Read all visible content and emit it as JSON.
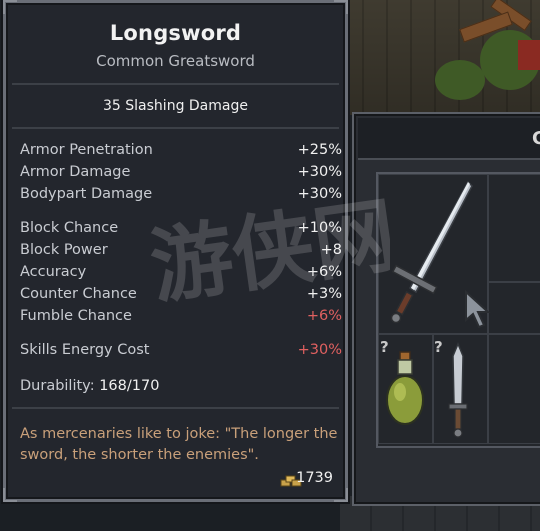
{
  "tooltip": {
    "title": "Longsword",
    "subtitle": "Common Greatsword",
    "damage": "35 Slashing Damage",
    "stats_group_1": [
      {
        "label": "Armor Penetration",
        "value": "+25%",
        "negative": false
      },
      {
        "label": "Armor Damage",
        "value": "+30%",
        "negative": false
      },
      {
        "label": "Bodypart Damage",
        "value": "+30%",
        "negative": false
      }
    ],
    "stats_group_2": [
      {
        "label": "Block Chance",
        "value": "+10%",
        "negative": false
      },
      {
        "label": "Block Power",
        "value": "+8",
        "negative": false
      },
      {
        "label": "Accuracy",
        "value": "+6%",
        "negative": false
      },
      {
        "label": "Counter Chance",
        "value": "+3%",
        "negative": false
      },
      {
        "label": "Fumble Chance",
        "value": "+6%",
        "negative": true
      }
    ],
    "stats_group_3": [
      {
        "label": "Skills Energy Cost",
        "value": "+30%",
        "negative": true
      }
    ],
    "durability_label": "Durability:",
    "durability_value": "168/170",
    "flavor_text": "As mercenaries like to joke: \"The longer the sword, the shorter the enemies\".",
    "price": "1739"
  },
  "inventory": {
    "header_letter": "C",
    "unknown_marker": "?",
    "items": [
      {
        "icon": "longsword-icon"
      },
      {
        "icon": "potion-icon"
      },
      {
        "icon": "dagger-icon"
      }
    ]
  },
  "colors": {
    "negative_value": "#e06060",
    "flavor": "#c9a07a",
    "panel_bg": "#23262d"
  },
  "watermark_glyphs": "游侠网"
}
